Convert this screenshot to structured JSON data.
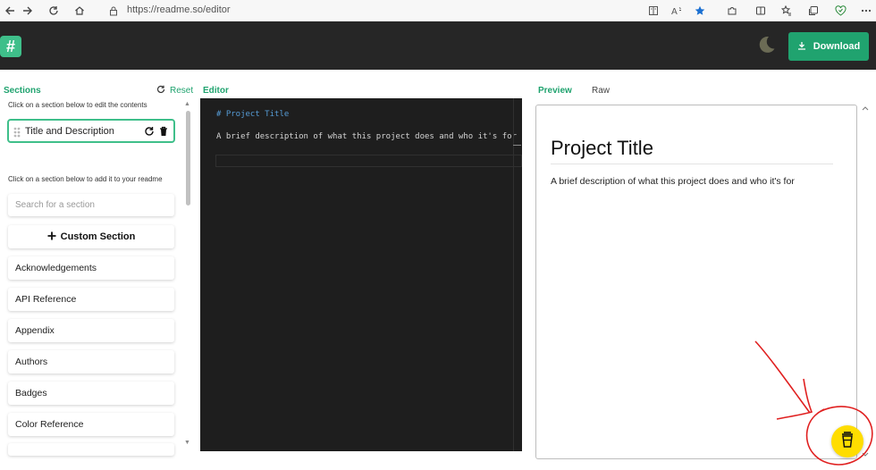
{
  "browser": {
    "url": "https://readme.so/editor"
  },
  "header": {
    "logo_glyph": "#",
    "download_label": "Download"
  },
  "sections_panel": {
    "heading": "Sections",
    "reset_label": "Reset",
    "edit_hint": "Click on a section below to edit the contents",
    "selected_section": "Title and Description",
    "add_hint": "Click on a section below to add it to your readme",
    "search_placeholder": "Search for a section",
    "custom_section_label": "Custom Section",
    "items": [
      {
        "label": "Acknowledgements"
      },
      {
        "label": "API Reference"
      },
      {
        "label": "Appendix"
      },
      {
        "label": "Authors"
      },
      {
        "label": "Badges"
      },
      {
        "label": "Color Reference"
      },
      {
        "label": ""
      }
    ]
  },
  "editor": {
    "heading": "Editor",
    "line1": "# Project Title",
    "line2": "A brief description of what this project does and who it's for"
  },
  "preview": {
    "tab_preview": "Preview",
    "tab_raw": "Raw",
    "title": "Project Title",
    "description": "A brief description of what this project does and who it's for"
  },
  "colors": {
    "accent": "#20a36f",
    "header_bg": "#262626",
    "editor_bg": "#1e1e1e",
    "annotation": "#e02020",
    "coffee_button": "#ffdd00"
  },
  "icons": {
    "back": "arrow-left-icon",
    "forward": "arrow-right-icon",
    "reload": "reload-icon",
    "home": "home-icon",
    "lock": "lock-icon",
    "theme": "moon-icon",
    "download": "download-icon",
    "reset": "refresh-icon",
    "delete": "trash-icon",
    "add": "plus-icon",
    "coffee": "coffee-cup-icon"
  }
}
